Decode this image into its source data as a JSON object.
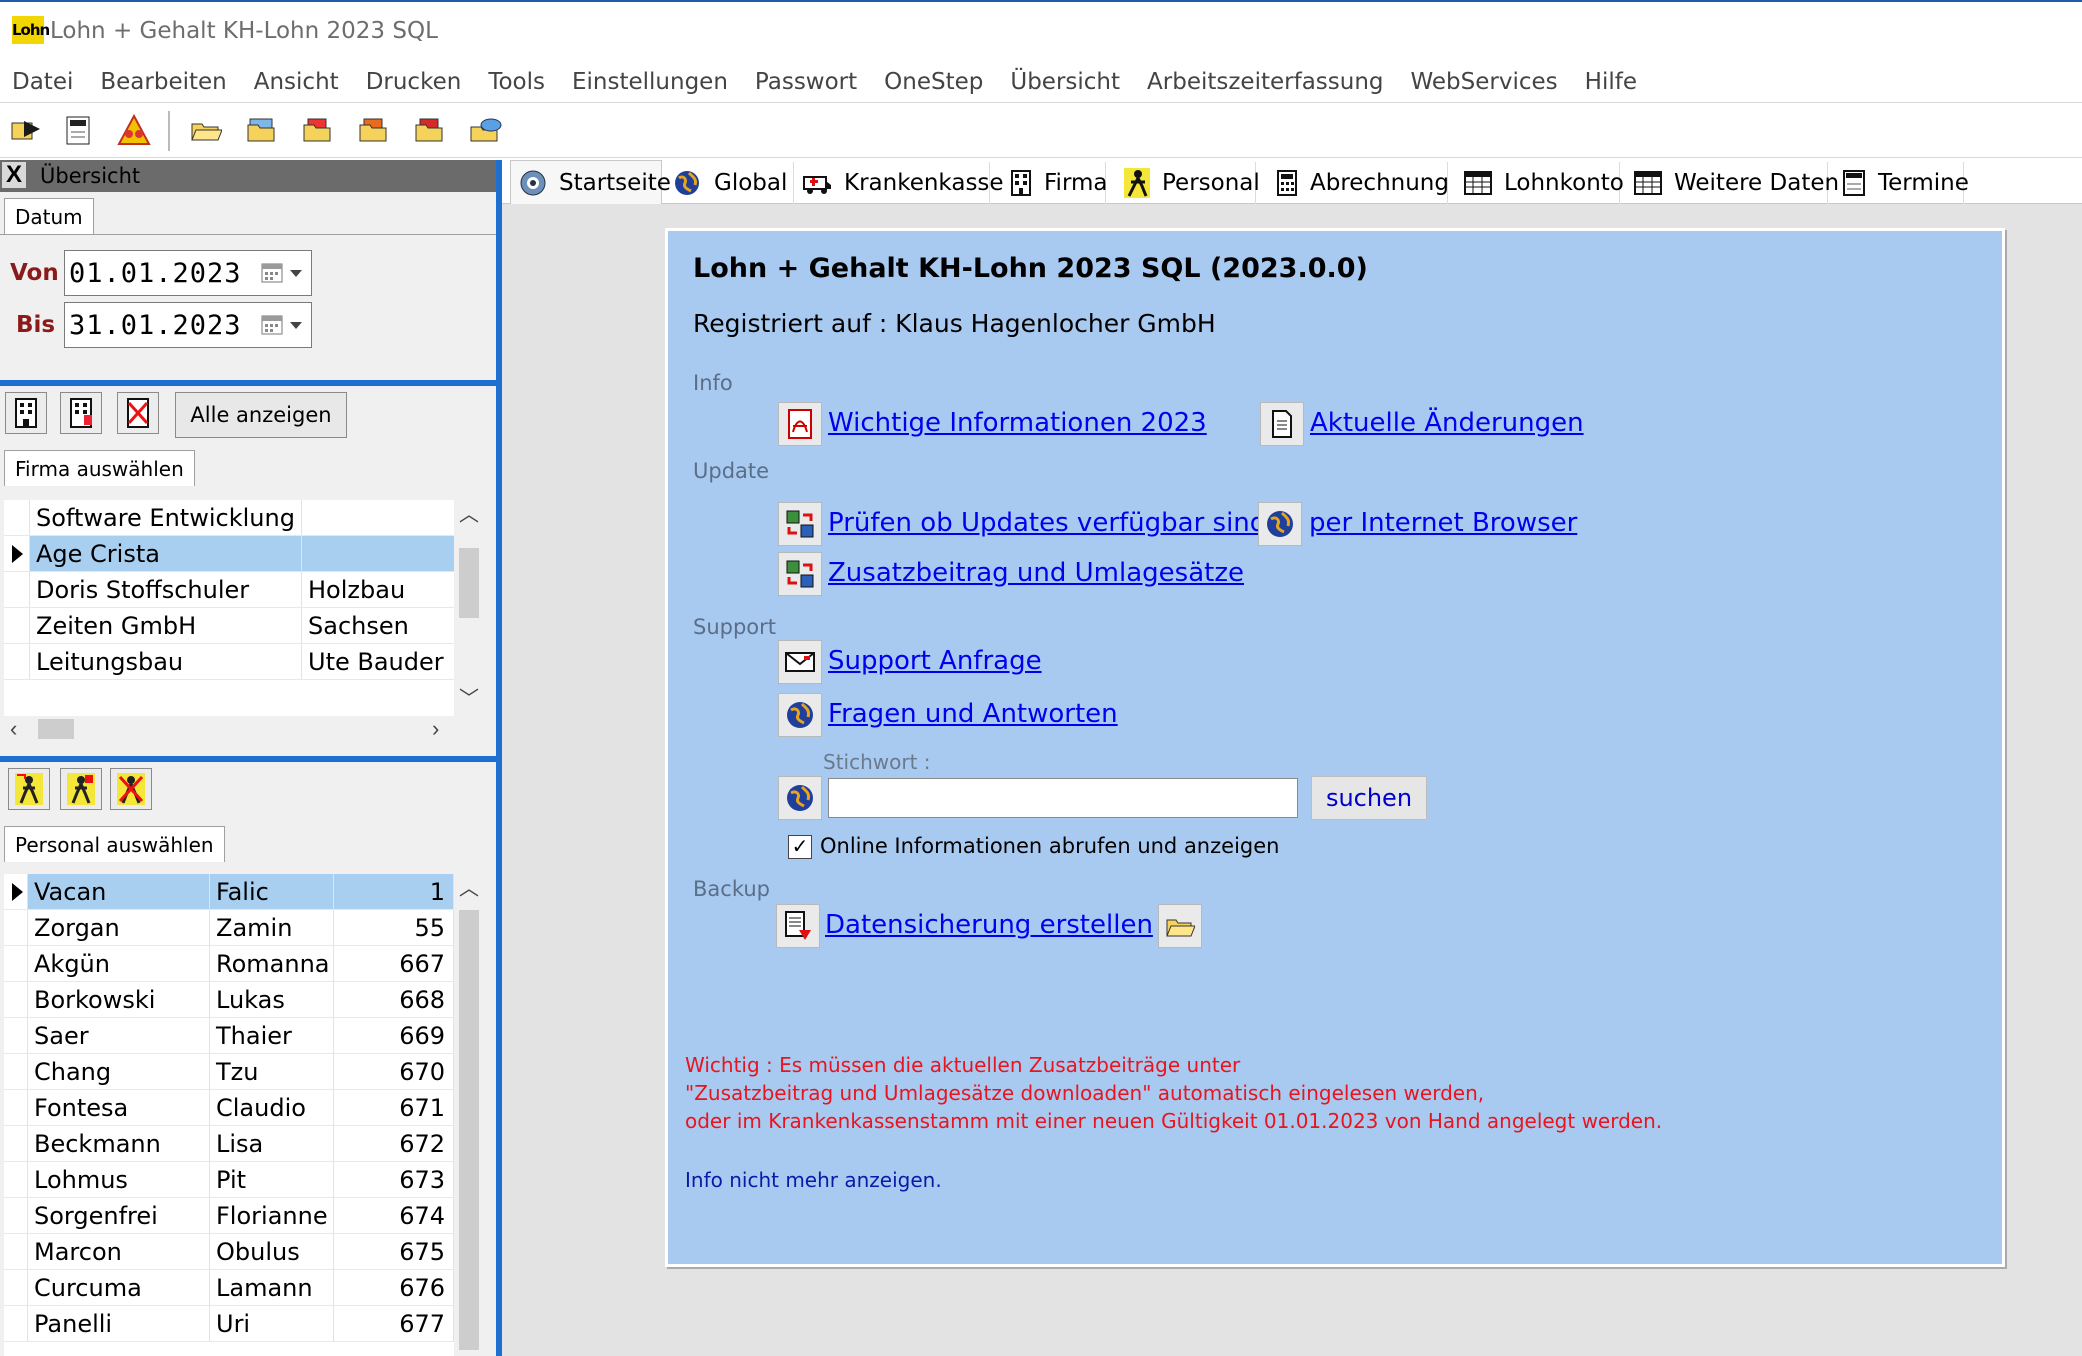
{
  "app": {
    "logo_text": "Lohn",
    "title": "Lohn + Gehalt KH-Lohn 2023 SQL"
  },
  "menu": [
    "Datei",
    "Bearbeiten",
    "Ansicht",
    "Drucken",
    "Tools",
    "Einstellungen",
    "Passwort",
    "OneStep",
    "Übersicht",
    "Arbeitszeiterfassung",
    "WebServices",
    "Hilfe"
  ],
  "toolbar": {
    "icons": [
      "open-arrow-icon",
      "calendar-jan-icon",
      "warning-people-icon",
      "folder-open-icon",
      "folder-stack-icon",
      "folder-red-icon",
      "folder-orange-icon",
      "folder-red2-icon",
      "cloud-folder-icon"
    ]
  },
  "overview": {
    "title": "Übersicht",
    "close_glyph": "X",
    "date_tab": "Datum",
    "von_label": "Von",
    "von_value": "01.01.2023",
    "bis_label": "Bis",
    "bis_value": "31.01.2023",
    "show_all": "Alle anzeigen",
    "firma_tab": "Firma auswählen",
    "personal_tab": "Personal auswählen"
  },
  "firma_rows": [
    {
      "name": "Software Entwicklung",
      "extra": ""
    },
    {
      "name": "Age Crista",
      "extra": "",
      "selected": true
    },
    {
      "name": "Doris Stoffschuler",
      "extra": "Holzbau"
    },
    {
      "name": "Zeiten GmbH",
      "extra": "Sachsen"
    },
    {
      "name": "Leitungsbau",
      "extra": "Ute Bauder"
    }
  ],
  "personal_rows": [
    {
      "last": "Vacan",
      "first": "Falic",
      "nr": "1",
      "selected": true
    },
    {
      "last": "Zorgan",
      "first": "Zamin",
      "nr": "55"
    },
    {
      "last": "Akgün",
      "first": "Romanna",
      "nr": "667"
    },
    {
      "last": "Borkowski",
      "first": "Lukas",
      "nr": "668"
    },
    {
      "last": "Saer",
      "first": "Thaier",
      "nr": "669"
    },
    {
      "last": "Chang",
      "first": "Tzu",
      "nr": "670"
    },
    {
      "last": "Fontesa",
      "first": "Claudio",
      "nr": "671"
    },
    {
      "last": "Beckmann",
      "first": "Lisa",
      "nr": "672"
    },
    {
      "last": "Lohmus",
      "first": "Pit",
      "nr": "673"
    },
    {
      "last": "Sorgenfrei",
      "first": "Florianne",
      "nr": "674"
    },
    {
      "last": "Marcon",
      "first": "Obulus",
      "nr": "675"
    },
    {
      "last": "Curcuma",
      "first": "Lamann",
      "nr": "676"
    },
    {
      "last": "Panelli",
      "first": "Uri",
      "nr": "677"
    }
  ],
  "tabs": [
    {
      "label": "Startseite",
      "icon": "start-icon"
    },
    {
      "label": "Global",
      "icon": "globe-icon"
    },
    {
      "label": "Krankenkasse",
      "icon": "ambulance-icon"
    },
    {
      "label": "Firma",
      "icon": "building-icon"
    },
    {
      "label": "Personal",
      "icon": "person-icon"
    },
    {
      "label": "Abrechnung",
      "icon": "calculator-icon"
    },
    {
      "label": "Lohnkonto",
      "icon": "table-icon"
    },
    {
      "label": "Weitere Daten",
      "icon": "table2-icon"
    },
    {
      "label": "Termine",
      "icon": "calendar-icon"
    }
  ],
  "start": {
    "heading": "Lohn + Gehalt KH-Lohn 2023 SQL (2023.0.0)",
    "registered": "Registriert auf :  Klaus Hagenlocher GmbH",
    "info_label": "Info",
    "link_wichtige": "Wichtige Informationen 2023",
    "link_aktuelle": "Aktuelle Änderungen",
    "update_label": "Update",
    "link_pruefen": "Prüfen ob Updates verfügbar sind",
    "link_browser": "per Internet Browser",
    "link_zusatz": "Zusatzbeitrag und Umlagesätze",
    "support_label": "Support",
    "link_support": "Support Anfrage",
    "link_faq": "Fragen und Antworten",
    "stichwort_label": "Stichwort :",
    "search_value": "",
    "search_button": "suchen",
    "online_check_label": "Online Informationen abrufen und anzeigen",
    "online_checked": true,
    "backup_label": "Backup",
    "link_backup": "Datensicherung erstellen",
    "warn_line1": "Wichtig : Es müssen die aktuellen Zusatzbeiträge unter",
    "warn_line2": "\"Zusatzbeitrag und Umlagesätze downloaden\" automatisch eingelesen werden,",
    "warn_line3": "oder im Krankenkassenstamm mit einer neuen Gültigkeit 01.01.2023 von Hand angelegt werden.",
    "info_nicht": "Info nicht mehr anzeigen."
  },
  "colors": {
    "accent": "#1e6fd0",
    "card_bg": "#a9caf0",
    "link": "#0000ee",
    "warning": "#e8141e",
    "selection": "#a8cff0",
    "date_label": "#8b1a1a"
  }
}
